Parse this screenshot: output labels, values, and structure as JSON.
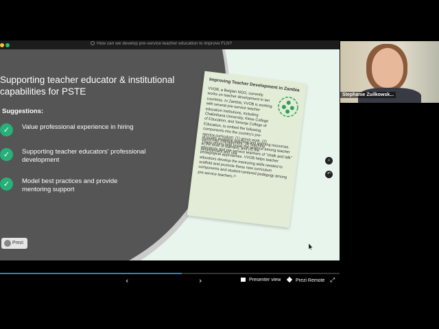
{
  "window": {
    "title": "How can we develop pre-service teacher education to improve FLN?",
    "traffic_colors": [
      "#f5c33b",
      "#f5c33b",
      "#2fbf5a"
    ]
  },
  "slide": {
    "title": "Supporting teacher educator & institutional capabilities for PSTE",
    "suggestions_label": "Suggestions:",
    "bullets": [
      "Value professional experience in hiring",
      "Supporting teacher educators' professional development",
      "Model best practices and provide mentoring support"
    ],
    "card": {
      "title": "Improving Teacher Development in Zambia",
      "body_top": "VVOB, a Belgian NGO, currently works on teacher development in ten countries. In Zambia, VVOB is working with several pre-service teacher education institutions, including Chalimbana University, Kitwe College of Education, and Serenje College of Education, to embed the following components into the country's pre-service curriculum: (1) group work, (2) classroom management, (3) teaching at the level of learners, and (4) the development and use",
      "body_bottom": "of locally available teaching and learning resources. These efforts help break the reliance among teacher educators and pre-service teachers of \"chalk and talk\" pedagogical approaches. VVOB helps teacher educators develop the mentoring skills needed to scaffold and promote these new curriculum components and student-centered pedagogy among pre-service teachers.³¹",
      "icon": "group-of-people-icon",
      "accent_color": "#2ea05a"
    },
    "badge": "Prezi",
    "nav_icons": [
      "home-icon",
      "back-icon"
    ]
  },
  "progress": {
    "fraction": 0.535,
    "color": "#2b7fd6"
  },
  "controls": {
    "prev_icon": "chevron-left-icon",
    "next_icon": "chevron-right-icon",
    "presenter_view": "Presenter view",
    "prezi_remote": "Prezi Remote",
    "fullscreen_icon": "expand-icon"
  },
  "webcam": {
    "name": "Stephanie Zuilkowsk..."
  }
}
